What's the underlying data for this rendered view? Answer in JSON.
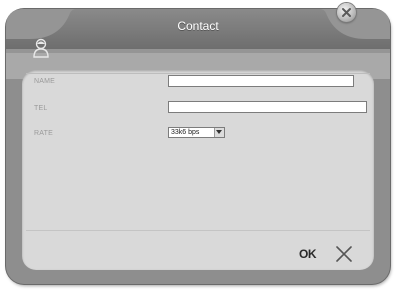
{
  "window": {
    "title": "Contact"
  },
  "form": {
    "name_label": "NAME",
    "name_value": "",
    "tel_label": "TEL",
    "tel_value": "",
    "rate_label": "RATE",
    "rate_value": "33k6 bps"
  },
  "footer": {
    "ok_label": "OK"
  },
  "icons": {
    "close": "close-icon",
    "avatar": "user-icon",
    "cancel": "cross-icon",
    "dropdown": "chevron-down-icon"
  },
  "colors": {
    "frame": "#8e8e8e",
    "panel": "#d9d9d9",
    "title_text": "#ffffff"
  }
}
